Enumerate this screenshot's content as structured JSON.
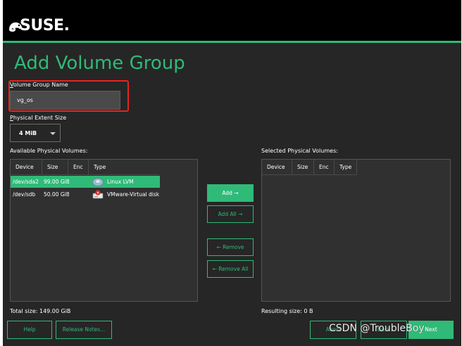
{
  "header": {
    "logo_text": "SUSE.",
    "accent_color": "#30ba78"
  },
  "page": {
    "title": "Add Volume Group"
  },
  "form": {
    "vg_name_label_key": "V",
    "vg_name_label_rest": "olume Group Name",
    "vg_name_value": "vg_os",
    "pe_label_key": "P",
    "pe_label_rest": "hysical Extent Size",
    "pe_value": "4 MiB"
  },
  "available": {
    "label": "Available Physical Volumes:",
    "columns": [
      "Device",
      "Size",
      "Enc",
      "Type"
    ],
    "rows": [
      {
        "device": "/dev/sda2",
        "size": "99.00 GiB",
        "enc": "",
        "type": "Linux LVM",
        "icon": "lvm-disk-icon",
        "selected": true
      },
      {
        "device": "/dev/sdb",
        "size": "50.00 GiB",
        "enc": "",
        "type": "VMware-Virtual disk",
        "icon": "hard-disk-icon",
        "selected": false
      }
    ],
    "total": "Total size: 149.00 GiB"
  },
  "selected": {
    "label": "Selected Physical Volumes:",
    "columns": [
      "Device",
      "Size",
      "Enc",
      "Type"
    ],
    "total": "Resulting size: 0 B"
  },
  "actions": {
    "add": "Add →",
    "add_all": "Add All →",
    "remove": "← Remove",
    "remove_all": "← Remove All"
  },
  "footer": {
    "help": "Help",
    "release_notes": "Release Notes...",
    "abort": "Abort",
    "back": "Back",
    "next": "Next"
  },
  "watermark": "CSDN @TroubleBoy"
}
